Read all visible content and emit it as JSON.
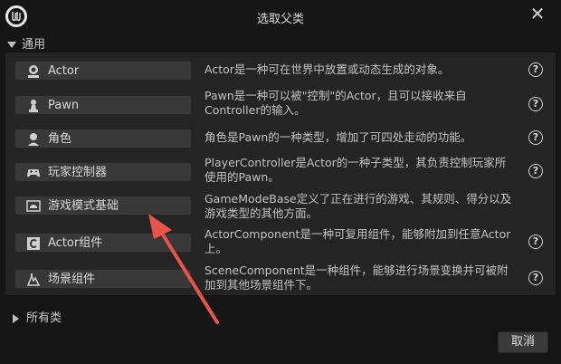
{
  "window": {
    "title": "选取父类",
    "close_glyph": "✕"
  },
  "section_common": {
    "label": "通用"
  },
  "classes": [
    {
      "label": "Actor",
      "icon": "actor-icon",
      "description": "Actor是一种可在世界中放置或动态生成的对象。"
    },
    {
      "label": "Pawn",
      "icon": "pawn-icon",
      "description": "Pawn是一种可以被\"控制\"的Actor，且可以接收来自Controller的输入。"
    },
    {
      "label": "角色",
      "icon": "character-icon",
      "description": "角色是Pawn的一种类型，增加了可四处走动的功能。"
    },
    {
      "label": "玩家控制器",
      "icon": "gamepad-icon",
      "description": "PlayerController是Actor的一种子类型，其负责控制玩家所使用的Pawn。"
    },
    {
      "label": "游戏模式基础",
      "icon": "game-mode-icon",
      "description": "GameModeBase定义了正在进行的游戏、其规则、得分以及游戏类型的其他方面。"
    },
    {
      "label": "Actor组件",
      "icon": "actor-component-icon",
      "description": "ActorComponent是一种可复用组件，能够附加到任意Actor上。"
    },
    {
      "label": "场景组件",
      "icon": "scene-component-icon",
      "description": "SceneComponent是一种组件，能够进行场景变换并可被附加到其他场景组件下。"
    }
  ],
  "help_glyph": "?",
  "section_all": {
    "label": "所有类"
  },
  "footer": {
    "cancel_label": "取消"
  },
  "colors": {
    "arrow": "#e8534a",
    "background": "#151515",
    "panel": "#242424",
    "button": "#383838"
  }
}
